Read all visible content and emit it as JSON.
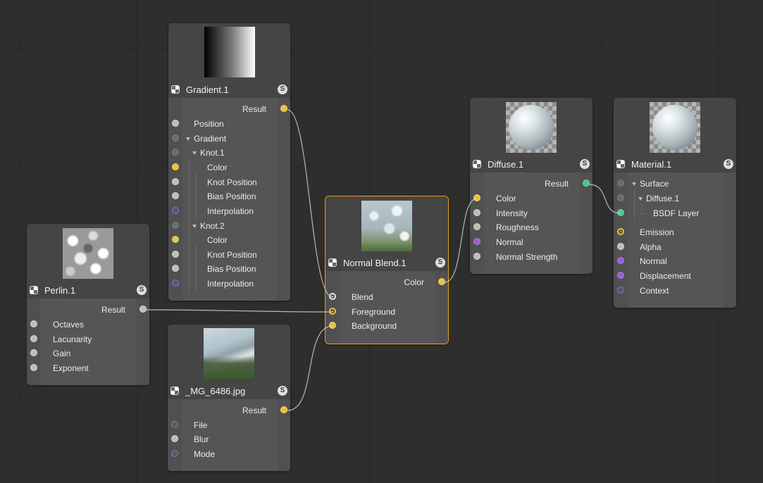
{
  "nodes": {
    "gradient": {
      "title": "Gradient.1",
      "output": "Result",
      "rows": [
        "Position",
        "Gradient",
        "Knot.1",
        "Color",
        "Knot Position",
        "Bias Position",
        "Interpolation",
        "Knot.2",
        "Color",
        "Knot Position",
        "Bias Position",
        "Interpolation"
      ]
    },
    "perlin": {
      "title": "Perlin.1",
      "output": "Result",
      "rows": [
        "Octaves",
        "Lacunarity",
        "Gain",
        "Exponent"
      ]
    },
    "image": {
      "title": "_MG_6486.jpg",
      "output": "Result",
      "rows": [
        "File",
        "Blur",
        "Mode"
      ]
    },
    "blend": {
      "title": "Normal Blend.1",
      "output": "Color",
      "rows": [
        "Blend",
        "Foreground",
        "Background"
      ]
    },
    "diffuse": {
      "title": "Diffuse.1",
      "output": "Result",
      "rows": [
        "Color",
        "Intensity",
        "Roughness",
        "Normal",
        "Normal Strength"
      ]
    },
    "material": {
      "title": "Material.1",
      "rows": [
        "Surface",
        "Diffuse.1",
        "BSDF Layer",
        "Emission",
        "Alpha",
        "Normal",
        "Displacement",
        "Context"
      ]
    }
  },
  "badge": "S",
  "colors": {
    "canvas": "#2e2e2e",
    "grid": "#262626",
    "node": "#454545",
    "selected_outline": "#e4a51e",
    "port_yellow": "#e8c43b",
    "port_green": "#47c78a",
    "port_purple": "#a25bd1",
    "port_blue": "#6f7fe6",
    "wire": "#c9c9c9"
  }
}
